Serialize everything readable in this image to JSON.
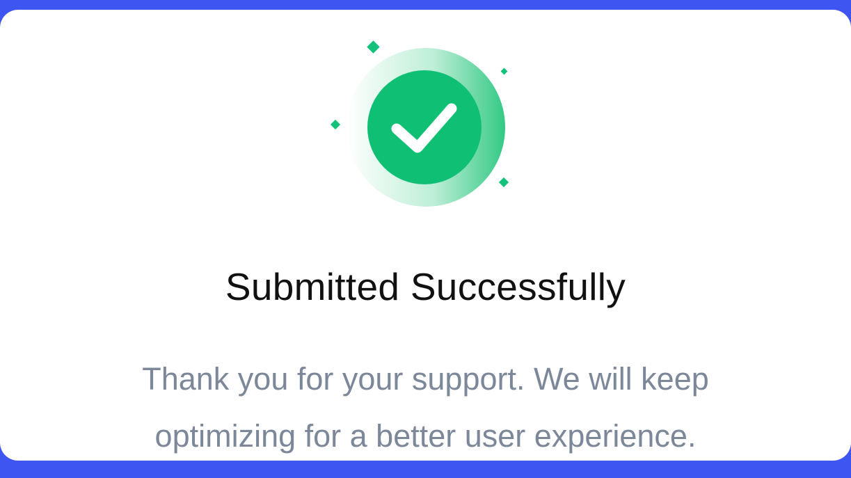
{
  "dialog": {
    "icon": "check-circle-icon",
    "title": "Submitted Successfully",
    "message_lines": [
      "Thank you for your support. We will keep",
      "optimizing for a better user experience."
    ]
  },
  "colors": {
    "frame_background": "#3e55f2",
    "card_background": "#ffffff",
    "success_green": "#0fc074",
    "title_text": "#111111",
    "message_text": "#7c8799"
  }
}
